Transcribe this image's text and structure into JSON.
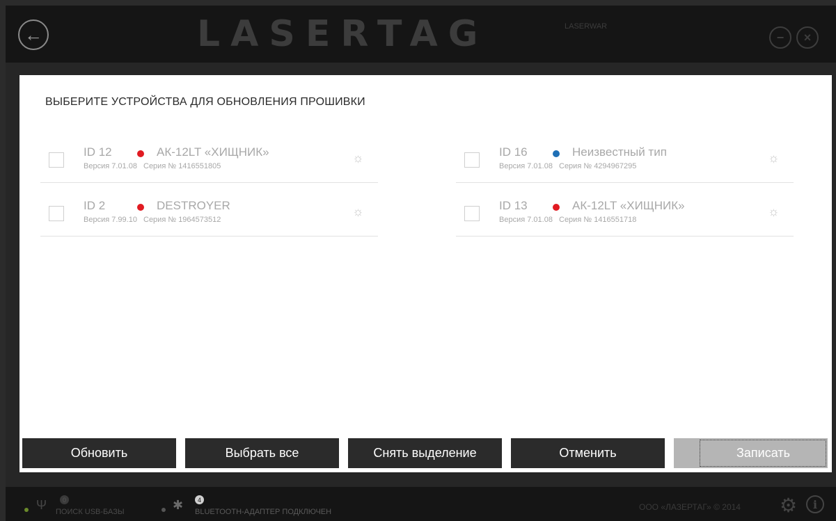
{
  "header": {
    "back_icon": "arrow-left-icon",
    "logo": "LASERTAG",
    "logo_small": "LASERWAR",
    "minimize_icon": "minus-icon",
    "close_icon": "x-icon"
  },
  "dialog": {
    "title": "ВЫБЕРИТЕ УСТРОЙСТВА ДЛЯ ОБНОВЛЕНИЯ ПРОШИВКИ",
    "devices": [
      {
        "id": "ID 12",
        "dot_color": "#e11b22",
        "name": "АК-12LT «ХИЩНИК»",
        "version": "Версия 7.01.08",
        "serial": "Серия № 1416551805"
      },
      {
        "id": "ID 16",
        "dot_color": "#1f6fb5",
        "name": "Неизвестный тип",
        "version": "Версия 7.01.08",
        "serial": "Серия № 4294967295"
      },
      {
        "id": "ID 2",
        "dot_color": "#e11b22",
        "name": "DESTROYER",
        "version": "Версия 7.99.10",
        "serial": "Серия № 1964573512"
      },
      {
        "id": "ID 13",
        "dot_color": "#e11b22",
        "name": "АК-12LT «ХИЩНИК»",
        "version": "Версия 7.01.08",
        "serial": "Серия № 1416551718"
      }
    ],
    "buttons": {
      "refresh": "Обновить",
      "select_all": "Выбрать все",
      "deselect": "Снять выделение",
      "cancel": "Отменить",
      "write": "Записать"
    }
  },
  "statusbar": {
    "usb_badge": "0",
    "usb_text": "ПОИСК USB-БАЗЫ",
    "bt_badge": "4",
    "bt_text": "BLUETOOTH-АДАПТЕР ПОДКЛЮЧЕН",
    "copyright": "ООО «ЛАЗЕРТАГ» © 2014",
    "usb_dot_color": "#6a8a2a",
    "bt_dot_color": "#555555"
  }
}
